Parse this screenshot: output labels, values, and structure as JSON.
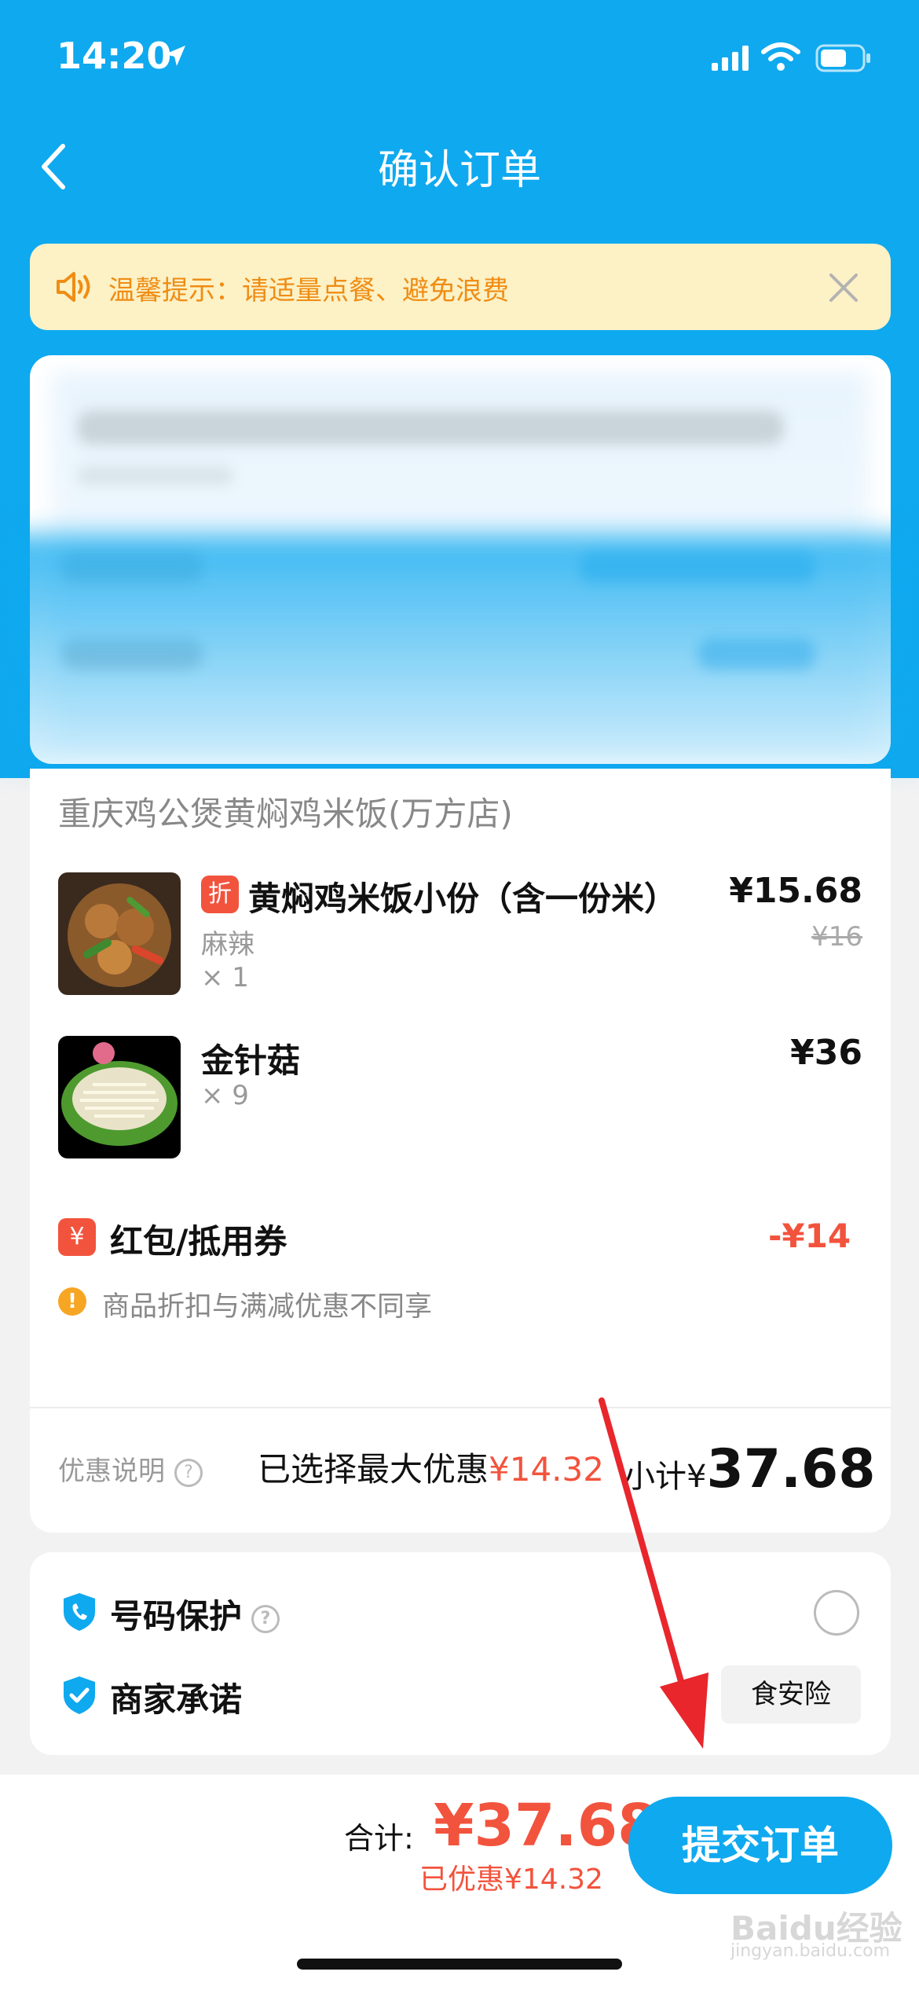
{
  "status": {
    "time": "14:20"
  },
  "nav": {
    "title": "确认订单"
  },
  "tip": {
    "text": "温馨提示：请适量点餐、避免浪费"
  },
  "order": {
    "shop_name": "重庆鸡公煲黄焖鸡米饭(万方店)",
    "items": [
      {
        "badge": "折",
        "name": "黄焖鸡米饭小份（含一份米）",
        "spec": "麻辣",
        "qty": "× 1",
        "price": "¥15.68",
        "orig_price": "¥16"
      },
      {
        "name": "金针菇",
        "qty": "× 9",
        "price": "¥36"
      }
    ],
    "coupon": {
      "icon": "¥",
      "label": "红包/抵用券",
      "value": "-¥14"
    },
    "warning": {
      "icon": "!",
      "text": "商品折扣与满减优惠不同享"
    },
    "discount": {
      "label": "优惠说明",
      "selected_prefix": "已选择最大优惠",
      "amount": "¥14.32"
    },
    "subtotal": {
      "prefix": "小计¥",
      "value": "37.68"
    }
  },
  "options": {
    "number_protect": "号码保护",
    "merchant_promise": "商家承诺",
    "tag": "食安险"
  },
  "footer": {
    "total_label": "合计:",
    "total_value": "¥37.68",
    "saved": "已优惠¥14.32",
    "submit": "提交订单"
  },
  "watermark": {
    "brand": "Baidu经验",
    "url": "jingyan.baidu.com"
  },
  "colors": {
    "primary": "#0fa9ef",
    "accent": "#f2533d",
    "tip_bg": "#fdf1c6",
    "tip_text": "#ef8d14"
  }
}
